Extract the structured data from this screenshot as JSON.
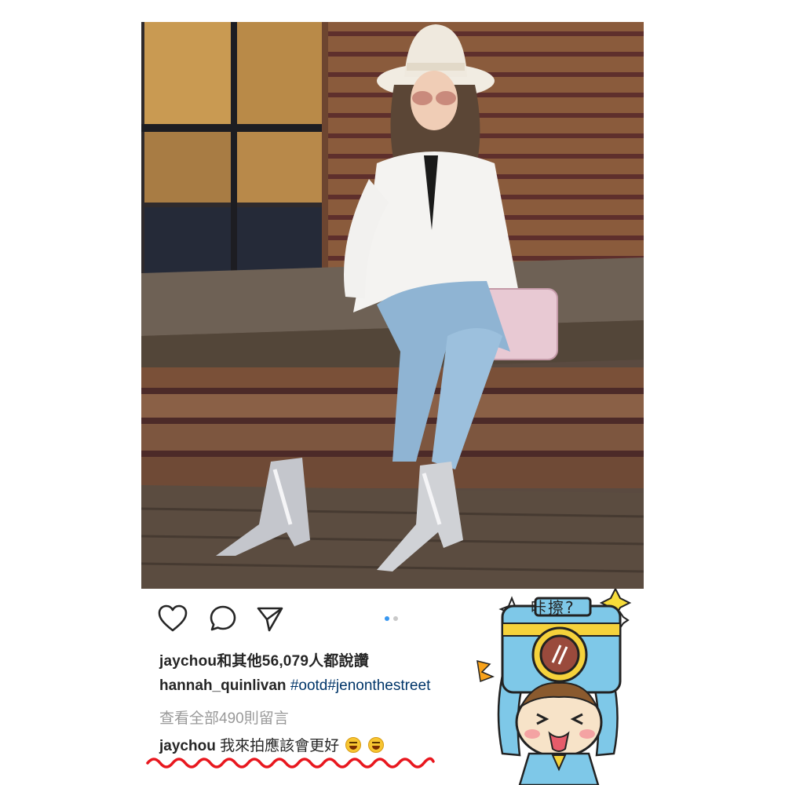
{
  "post": {
    "likes_text": "jaychou和其他56,079人都說讚",
    "caption_user": "hannah_quinlivan",
    "caption_tags": "#ootd#jenonthestreet",
    "view_all_comments": "查看全部490則留言",
    "comment_user": "jaychou",
    "comment_text": "我來拍應該會更好"
  },
  "actions": {
    "icons": [
      "heart-icon",
      "comment-icon",
      "share-icon"
    ]
  },
  "carousel": {
    "pages": 2,
    "current": 1
  },
  "sticker": {
    "text": "咔擦?"
  },
  "colors": {
    "accent_blue": "#3897f0",
    "hashtag": "#003569",
    "muted": "#999999",
    "squiggle": "#e8171e"
  }
}
